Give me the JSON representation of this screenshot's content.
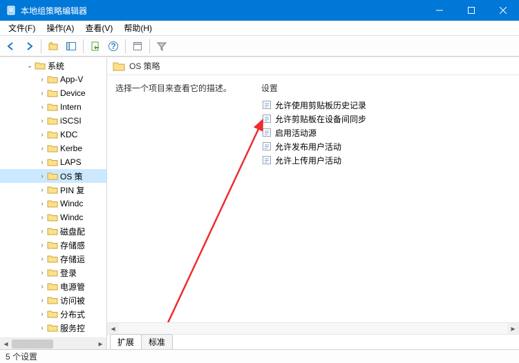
{
  "window": {
    "title": "本地组策略编辑器"
  },
  "menu": {
    "file": "文件(F)",
    "action": "操作(A)",
    "view": "查看(V)",
    "help": "帮助(H)"
  },
  "tree": {
    "root": "系统",
    "items": [
      {
        "label": "App-V"
      },
      {
        "label": "Device"
      },
      {
        "label": "Intern"
      },
      {
        "label": "iSCSI"
      },
      {
        "label": "KDC"
      },
      {
        "label": "Kerbe"
      },
      {
        "label": "LAPS"
      },
      {
        "label": "OS 策",
        "selected": true
      },
      {
        "label": "PIN 复"
      },
      {
        "label": "Windc"
      },
      {
        "label": "Windc"
      },
      {
        "label": "磁盘配"
      },
      {
        "label": "存储感"
      },
      {
        "label": "存储运"
      },
      {
        "label": "登录"
      },
      {
        "label": "电源管"
      },
      {
        "label": "访问被"
      },
      {
        "label": "分布式"
      },
      {
        "label": "服务控"
      }
    ]
  },
  "detail": {
    "title": "OS 策略",
    "description": "选择一个项目来查看它的描述。",
    "column_header": "设置",
    "settings": [
      "允许使用剪贴板历史记录",
      "允许剪贴板在设备间同步",
      "启用活动源",
      "允许发布用户活动",
      "允许上传用户活动"
    ]
  },
  "tabs": {
    "extended": "扩展",
    "standard": "标准"
  },
  "status": {
    "text": "5 个设置"
  }
}
